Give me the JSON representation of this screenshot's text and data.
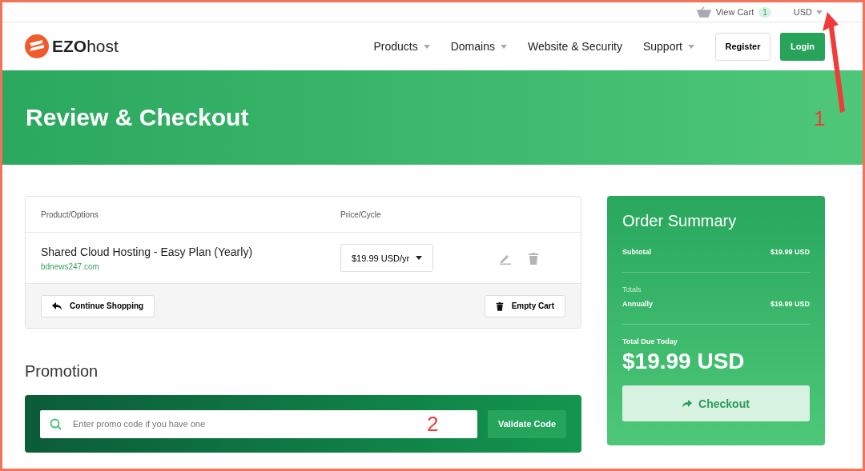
{
  "topbar": {
    "cart_label": "View Cart",
    "cart_count": "1",
    "currency": "USD"
  },
  "header": {
    "logo": "**EZO**host",
    "nav": [
      {
        "label": "Products",
        "dropdown": true
      },
      {
        "label": "Domains",
        "dropdown": true
      },
      {
        "label": "Website & Security",
        "dropdown": false
      },
      {
        "label": "Support",
        "dropdown": true
      }
    ],
    "register": "Register",
    "login": "Login"
  },
  "hero": {
    "title": "Review & Checkout"
  },
  "cart": {
    "columns": [
      "Product/Options",
      "Price/Cycle"
    ],
    "items": [
      {
        "name": "Shared Cloud Hosting - Easy Plan (Yearly)",
        "domain": "bdnews247.com",
        "price": "$19.99 USD/yr"
      }
    ],
    "continue": "Continue Shopping",
    "empty": "Empty Cart"
  },
  "promotion": {
    "title": "Promotion",
    "placeholder": "Enter promo code if you have one",
    "button": "Validate Code"
  },
  "summary": {
    "title": "Order Summary",
    "subtotal_label": "Subtotal",
    "subtotal": "$19.99 USD",
    "totals_label": "Totals",
    "cycle_label": "Annually",
    "cycle_total": "$19.99 USD",
    "due_label": "Total Due Today",
    "due": "$19.99 USD",
    "checkout": "Checkout"
  },
  "annotations": [
    "1",
    "2"
  ]
}
